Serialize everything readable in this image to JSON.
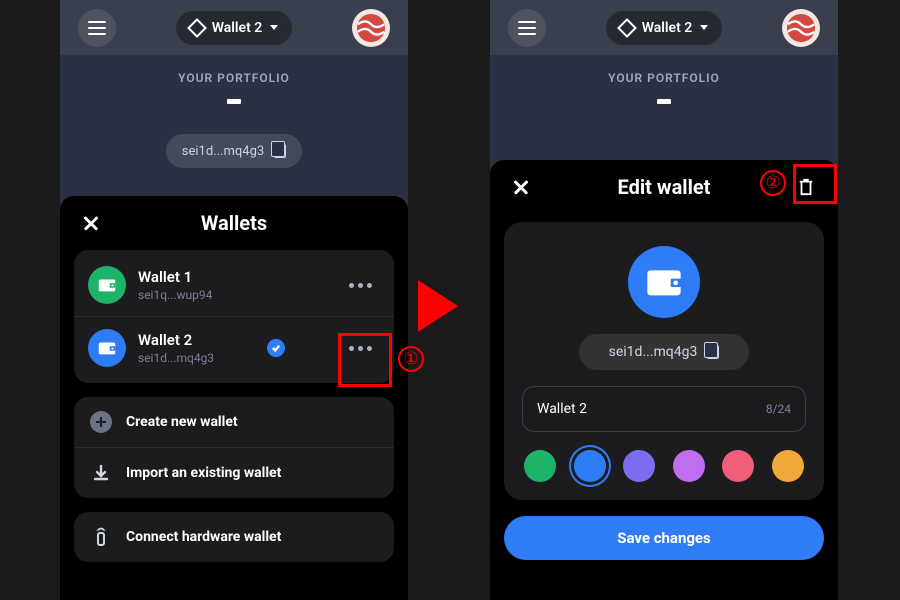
{
  "topbar": {
    "wallet_label": "Wallet 2"
  },
  "portfolio": {
    "label": "YOUR PORTFOLIO",
    "address": "sei1d...mq4g3"
  },
  "wallets_sheet": {
    "title": "Wallets",
    "items": [
      {
        "name": "Wallet 1",
        "addr": "sei1q...wup94",
        "color": "green",
        "selected": false
      },
      {
        "name": "Wallet 2",
        "addr": "sei1d...mq4g3",
        "color": "blue",
        "selected": true
      }
    ],
    "options": {
      "create": "Create new wallet",
      "import": "Import an existing wallet",
      "hardware": "Connect hardware wallet"
    }
  },
  "edit_sheet": {
    "title": "Edit wallet",
    "address": "sei1d...mq4g3",
    "name_value": "Wallet 2",
    "char_count": "8/24",
    "swatches": [
      "#1db46a",
      "#2f7df6",
      "#7a6df0",
      "#c06df0",
      "#f05e7a",
      "#f0a93a"
    ],
    "selected_swatch": 1,
    "save_label": "Save changes"
  },
  "annotations": {
    "step1": "①",
    "step2": "②"
  }
}
